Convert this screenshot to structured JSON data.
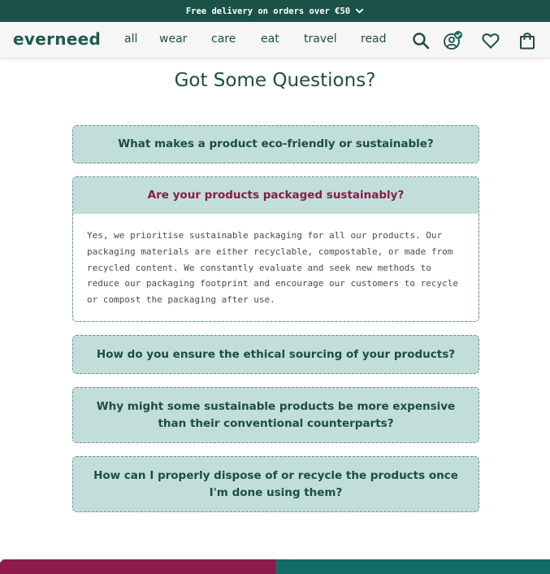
{
  "promo": {
    "text": "Free delivery on orders over €50",
    "icon": "chevron-down-icon"
  },
  "header": {
    "logo": "everneed",
    "nav": [
      "all",
      "wear",
      "care",
      "eat",
      "travel",
      "read"
    ],
    "icons": [
      "search-icon",
      "account-icon",
      "heart-icon",
      "bag-icon"
    ]
  },
  "faq": {
    "title": "Got Some Questions?",
    "items": [
      {
        "question": "What makes a product eco-friendly or sustainable?"
      },
      {
        "question": "Are your products packaged sustainably?",
        "expanded": true,
        "answer": "Yes, we prioritise sustainable packaging for all our products. Our packaging materials are either recyclable, compostable, or made from recycled content. We constantly evaluate and seek new methods to reduce our packaging footprint and encourage our customers to recycle or compost the packaging after use."
      },
      {
        "question": "How do you ensure the ethical sourcing of your products?"
      },
      {
        "question": "Why might some sustainable products be more expensive than their conventional counterparts?"
      },
      {
        "question": "How can I properly dispose of or recycle the products once I'm done using them?"
      }
    ]
  },
  "colors": {
    "brand_dark": "#1a5248",
    "faq_background": "#c1dedb",
    "accent": "#8c1a4a",
    "teal": "#136b65"
  }
}
